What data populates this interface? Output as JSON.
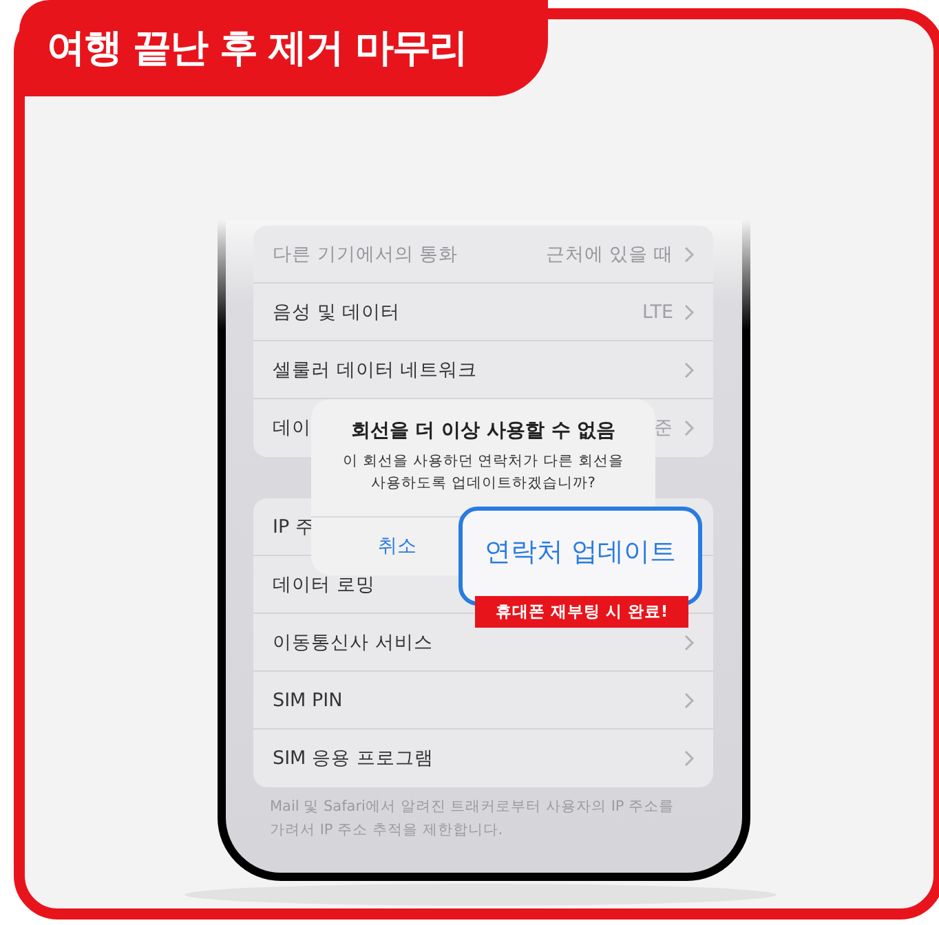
{
  "banner": {
    "title": "여행 끝난 후 제거 마무리"
  },
  "settings_groups": [
    {
      "rows": [
        {
          "label": "다른 기기에서의 통화",
          "value": "근처에 있을 때",
          "chevron": true
        },
        {
          "label": "음성 및 데이터",
          "value": "LTE",
          "chevron": true
        },
        {
          "label": "셀룰러 데이터 네트워크",
          "chevron": true
        },
        {
          "label": "데이",
          "value": "준",
          "chevron": true
        }
      ]
    },
    {
      "rows": [
        {
          "label": "IP 주",
          "chevron": false
        },
        {
          "label": "데이터 로밍",
          "chevron": false
        },
        {
          "label": "이동통신사 서비스",
          "chevron": true
        },
        {
          "label": "SIM PIN",
          "chevron": true
        },
        {
          "label": "SIM 응용 프로그램",
          "chevron": true
        }
      ]
    }
  ],
  "footer_note": "Mail 및 Safari에서 알려진 트래커로부터 사용자의 IP 주소를 가려서 IP 주소 추적을 제한합니다.",
  "dialog": {
    "title": "회선을 더 이상 사용할 수 없음",
    "message": "이 회선을 사용하던 연락처가 다른 회선을 사용하도록 업데이트하겠습니까?",
    "cancel_button": "취소"
  },
  "callout": {
    "label": "연락처 업데이트",
    "badge": "휴대폰 재부팅 시 완료!"
  }
}
